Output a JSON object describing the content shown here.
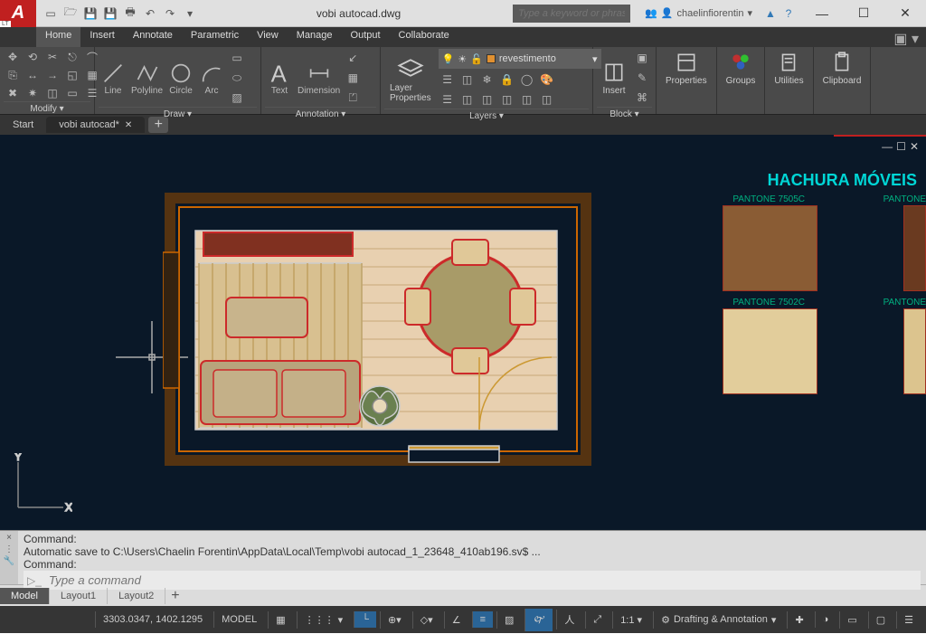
{
  "logo_lt": "LT",
  "title": "vobi autocad.dwg",
  "search_placeholder": "Type a keyword or phrase",
  "user_name": "chaelinfiorentin",
  "menu": [
    "Home",
    "Insert",
    "Annotate",
    "Parametric",
    "View",
    "Manage",
    "Output",
    "Collaborate"
  ],
  "ribbon": {
    "modify_title": "Modify ▾",
    "draw_title": "Draw ▾",
    "annotation_title": "Annotation ▾",
    "layers_title": "Layers ▾",
    "block_title": "Block ▾",
    "line": "Line",
    "polyline": "Polyline",
    "circle": "Circle",
    "arc": "Arc",
    "text": "Text",
    "dimension": "Dimension",
    "layer_props": "Layer\nProperties",
    "layer_name": "revestimento",
    "insert": "Insert",
    "properties": "Properties",
    "groups": "Groups",
    "utilities": "Utilities",
    "clipboard": "Clipboard"
  },
  "doc_tabs": {
    "start": "Start",
    "active": "vobi autocad*"
  },
  "canvas": {
    "swatch_title": "HACHURA MÓVEIS",
    "swatches": [
      {
        "label": "PANTONE 7505C",
        "color": "#8a5c34"
      },
      {
        "label": "PANTONE",
        "color": "#6a3a20"
      },
      {
        "label": "PANTONE 7502C",
        "color": "#e2cd9b"
      },
      {
        "label": "PANTONE",
        "color": "#dcc48e"
      }
    ]
  },
  "command": {
    "line1": "Command:",
    "line2": "Automatic save to C:\\Users\\Chaelin Forentin\\AppData\\Local\\Temp\\vobi autocad_1_23648_410ab196.sv$ ...",
    "line3": "Command:",
    "placeholder": "Type a command"
  },
  "layout_tabs": [
    "Model",
    "Layout1",
    "Layout2"
  ],
  "status": {
    "coords": "3303.0347, 1402.1295",
    "space": "MODEL",
    "scale": "1:1 ▾",
    "workspace": "Drafting & Annotation"
  }
}
